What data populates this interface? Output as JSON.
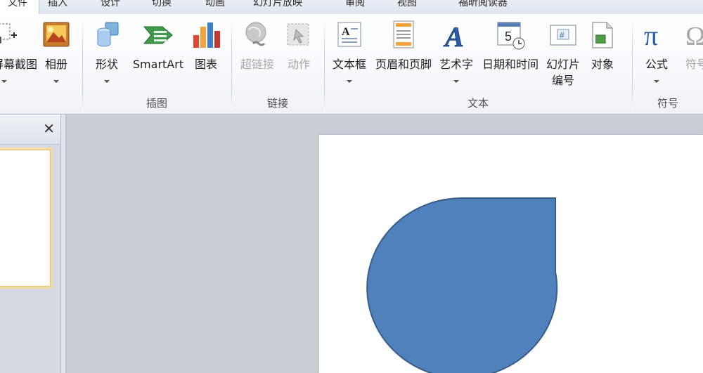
{
  "tabs": [
    {
      "label": "文件",
      "active": true
    },
    {
      "label": "插入",
      "active": false
    },
    {
      "label": "设计",
      "active": false
    },
    {
      "label": "切换",
      "active": false
    },
    {
      "label": "动画",
      "active": false
    },
    {
      "label": "幻灯片放映",
      "active": false
    },
    {
      "label": "审阅",
      "active": false
    },
    {
      "label": "视图",
      "active": false
    },
    {
      "label": "福昕阅读器",
      "active": false
    }
  ],
  "ribbon": {
    "images_group": {
      "screenshot": "屏幕截图",
      "album": "相册"
    },
    "illustrations_group": {
      "label": "插图",
      "shapes": "形状",
      "smartart": "SmartArt",
      "chart": "图表"
    },
    "links_group": {
      "label": "链接",
      "hyperlink": "超链接",
      "action": "动作"
    },
    "text_group": {
      "label": "文本",
      "textbox": "文本框",
      "header_footer": "页眉和页脚",
      "wordart": "艺术字",
      "datetime": "日期和时间",
      "slide_number_line1": "幻灯片",
      "slide_number_line2": "编号",
      "object": "对象"
    },
    "symbols_group": {
      "label": "符号",
      "equation": "公式",
      "symbol": "符号"
    }
  },
  "slide": {
    "shape": "teardrop",
    "fill": "#4f81bd",
    "stroke": "#385d8a"
  },
  "pane": {
    "close_glyph": "✕"
  },
  "colors": {
    "accent": "#4f81bd"
  }
}
